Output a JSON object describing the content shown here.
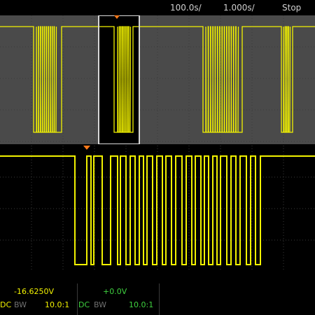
{
  "top_bar": {
    "time_scale": "100.0s/",
    "delay": "1.000s/",
    "run_state": "Stop"
  },
  "status_bar": {
    "ch1": {
      "offset": "-16.6250V",
      "coupling": "DC",
      "bw": "BW",
      "probe": "10.0:1"
    },
    "ch2": {
      "offset": "+0.0V",
      "coupling": "DC",
      "bw": "BW",
      "probe": "10.0:1"
    }
  },
  "colors": {
    "ch1": "#f2f200",
    "ch2": "#3fd13f",
    "marker": "#ff7a1a",
    "grid": "#3a3a3a",
    "overview_bg": "#4a4a4a",
    "zoom_box_border": "#d8d8d8"
  },
  "icons": {
    "trigger_marker": "orange-triangle-down"
  }
}
